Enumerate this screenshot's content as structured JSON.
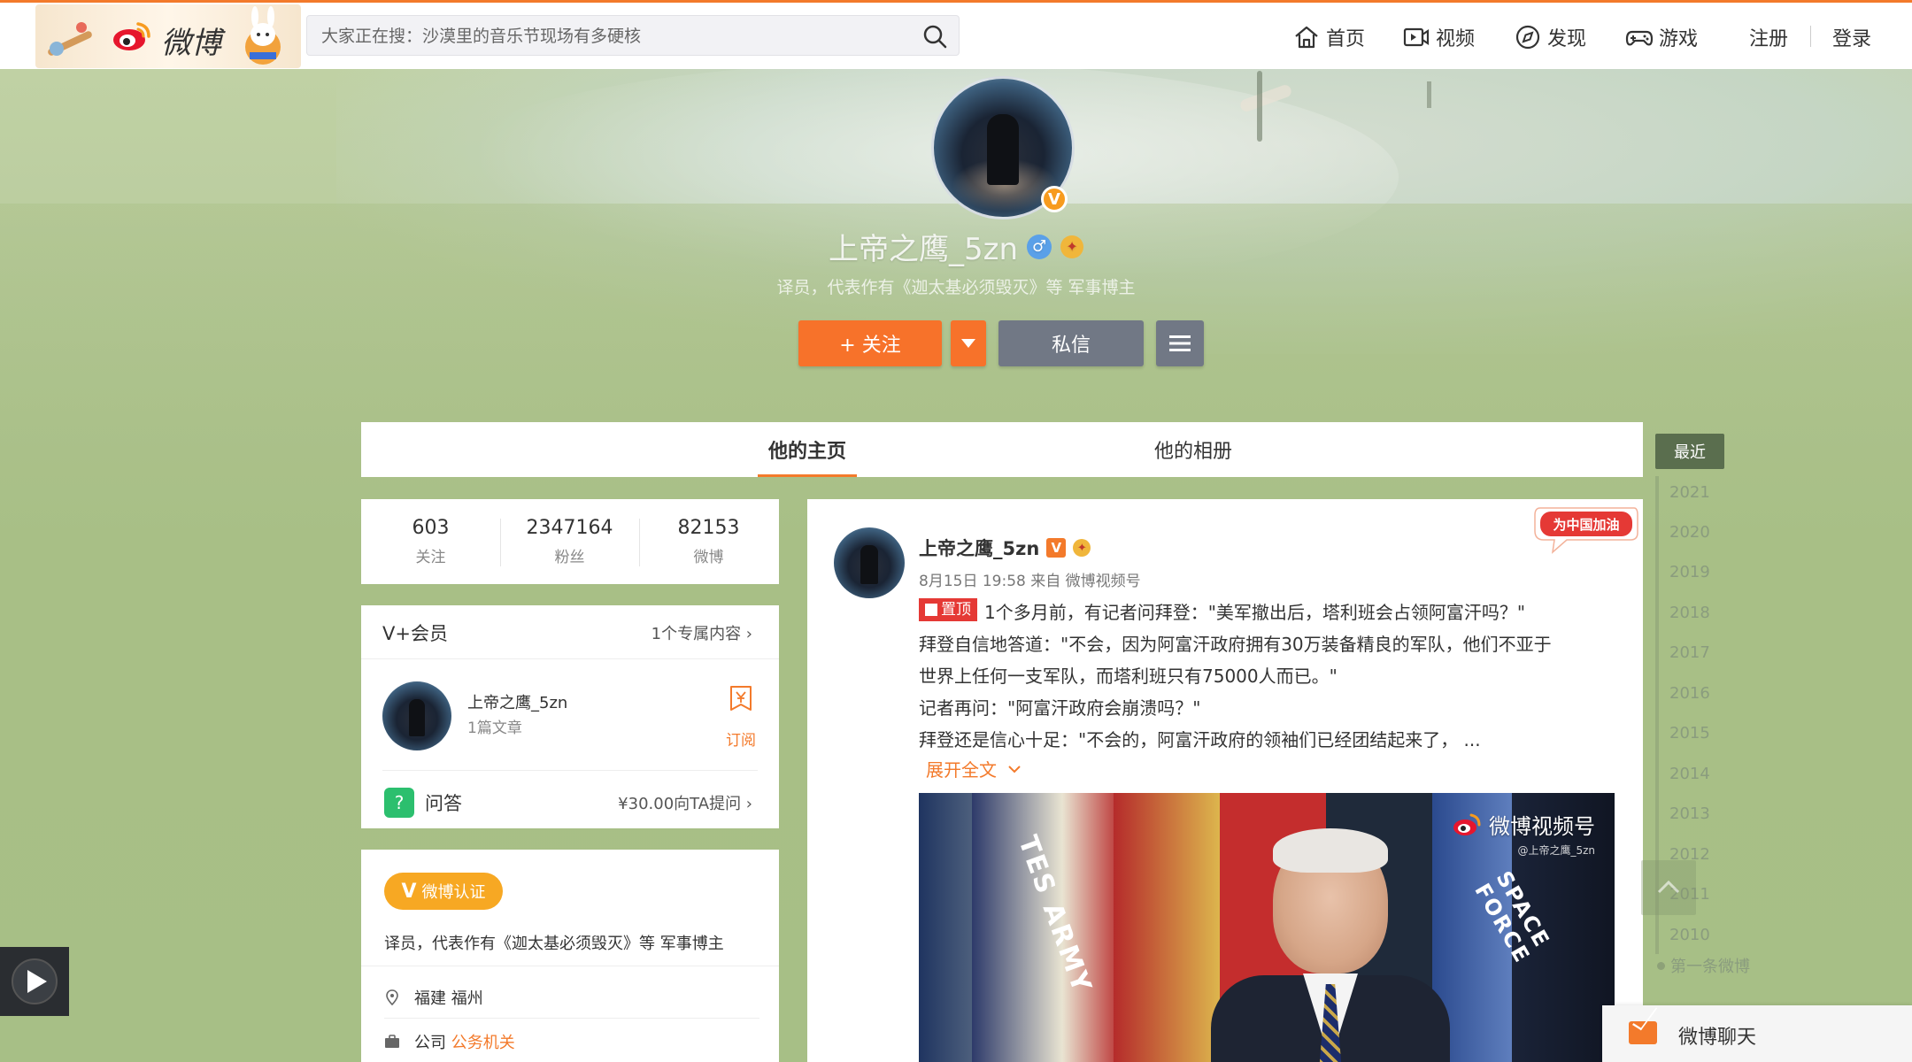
{
  "colors": {
    "accent": "#f37a2b",
    "follow": "#f7722a",
    "verify": "#f7a823",
    "qa": "#2cbf6e",
    "pin": "#e53935"
  },
  "topnav": {
    "logo": "微博",
    "search_placeholder": "大家正在搜：沙漠里的音乐节现场有多硬核",
    "items": [
      {
        "label": "首页",
        "icon": "home-icon"
      },
      {
        "label": "视频",
        "icon": "video-icon"
      },
      {
        "label": "发现",
        "icon": "compass-icon"
      },
      {
        "label": "游戏",
        "icon": "gamepad-icon"
      }
    ],
    "register": "注册",
    "login": "登录"
  },
  "profile": {
    "name": "上帝之鹰_5zn",
    "gender": "♂",
    "description": "译员，代表作有《迦太基必须毁灭》等 军事博主",
    "verified": "V",
    "follow_label": "+ 关注",
    "message_label": "私信"
  },
  "tabs": {
    "main": "他的主页",
    "album": "他的相册"
  },
  "stats": [
    {
      "value": "603",
      "label": "关注"
    },
    {
      "value": "2347164",
      "label": "粉丝"
    },
    {
      "value": "82153",
      "label": "微博"
    }
  ],
  "vip": {
    "title": "V+会员",
    "link": "1个专属内容 ›",
    "name": "上帝之鹰_5zn",
    "articles": "1篇文章",
    "subscribe": "订阅",
    "qa_icon": "?",
    "qa_label": "问答",
    "qa_price": "¥30.00向TA提问 ›"
  },
  "info": {
    "verify_badge": "微博认证",
    "verify_v": "V",
    "description": "译员，代表作有《迦太基必须毁灭》等 军事博主",
    "location": "福建 福州",
    "company_label": "公司",
    "company_value": "公务机关"
  },
  "post": {
    "name": "上帝之鹰_5zn",
    "meta": "8月15日 19:58 来自 微博视频号",
    "pin": "置顶",
    "lines": [
      "1个多月前，有记者问拜登：\"美军撤出后，塔利班会占领阿富汗吗？\"",
      "拜登自信地答道：\"不会，因为阿富汗政府拥有30万装备精良的军队，他们不亚于",
      "世界上任何一支军队，而塔利班只有75000人而已。\"",
      "记者再问：\"阿富汗政府会崩溃吗？\"",
      "拜登还是信心十足：\"不会的，阿富汗政府的领袖们已经团结起来了，  ..."
    ],
    "expand": "展开全文",
    "china_tag": "为中国加油",
    "video_logo": "微博视频号",
    "video_sub": "@上帝之鹰_5zn",
    "flag_left": "TES ARMY",
    "flag_right": "SPACE FORCE"
  },
  "timeline": {
    "recent": "最近",
    "years": [
      "2021",
      "2020",
      "2019",
      "2018",
      "2017",
      "2016",
      "2015",
      "2014",
      "2013",
      "2012",
      "2011",
      "2010"
    ],
    "first": "第一条微博"
  },
  "chat": {
    "label": "微博聊天"
  }
}
